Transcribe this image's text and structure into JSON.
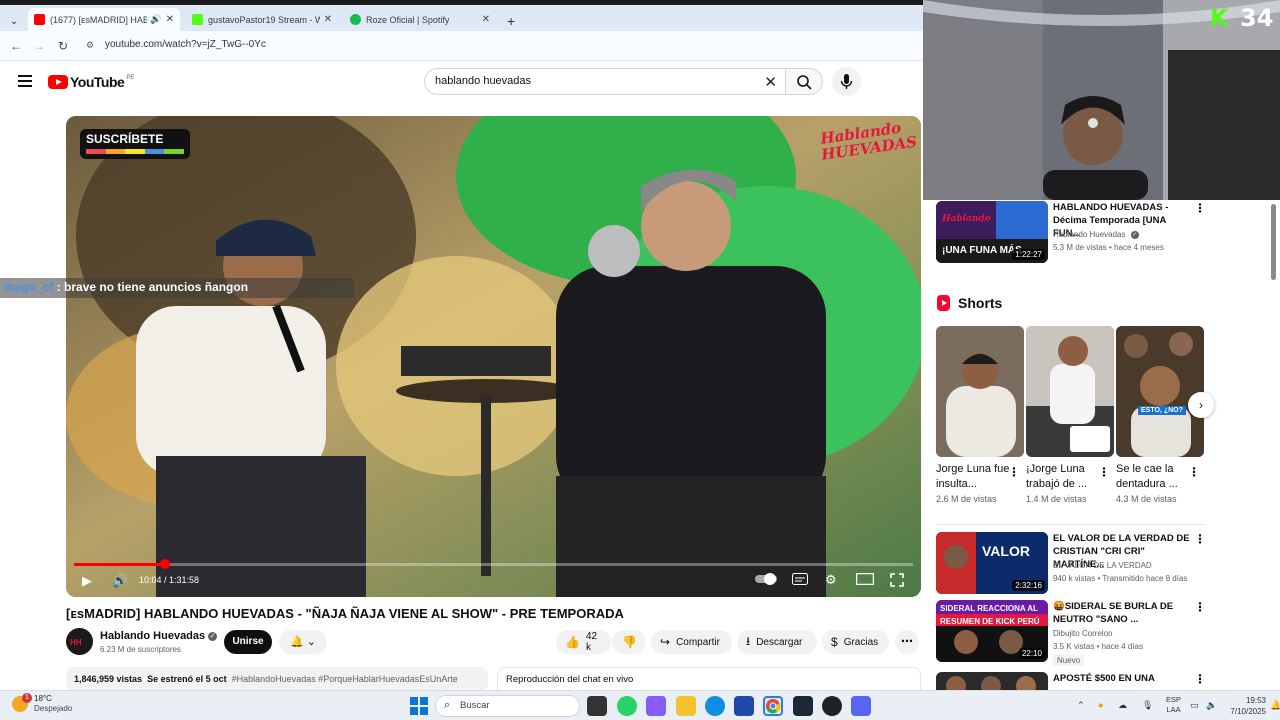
{
  "browser": {
    "tabs": [
      {
        "title": "(1677) [ᴇsMADRID] HABLANDO",
        "active": true,
        "favicon_color": "#ff0000"
      },
      {
        "title": "gustavoPastor19 Stream - Watch",
        "active": false,
        "favicon_color": "#53fc18"
      },
      {
        "title": "Roze Oficial | Spotify",
        "active": false,
        "favicon_color": "#1db954"
      }
    ],
    "url": "youtube.com/watch?v=jZ_TwG--0Yc"
  },
  "youtube": {
    "logo_text": "YouTube",
    "country": "PE",
    "search_value": "hablando huevadas",
    "video": {
      "sub_badge": "SUSCRÍBETE",
      "brand_watermark_line1": "Hablando",
      "brand_watermark_line2": "HUEVADAS",
      "chat_user": "mago_cf",
      "chat_message": " : brave no tiene anuncios ñangon",
      "time": "10:04 / 1:31:58",
      "progress": 0.109
    },
    "title": "[ᴇsMADRID] HABLANDO HUEVADAS - \"ÑAJA ÑAJA VIENE AL SHOW\" - PRE TEMPORADA",
    "channel": {
      "name": "Hablando Huevadas",
      "subscribers": "6.23 M de suscriptores"
    },
    "join_label": "Unirse",
    "likes": "42 k",
    "share_label": "Compartir",
    "download_label": "Descargar",
    "thanks_label": "Gracias",
    "description": {
      "views": "1,846,959 vistas",
      "premiered": "Se estrenó el 5 oct",
      "tags": "#HablandoHuevadas #PorqueHablarHuevadasEsUnArte"
    },
    "chat_replay_label": "Reproducción del chat en vivo",
    "recommendations_top": [
      {
        "title": "HABLANDO HUEVADAS - Décima Temporada [UNA FUN...",
        "channel": "Hablando Huevadas",
        "meta": "5.3 M de vistas • hace 4 meses",
        "duration": "1:22:27",
        "verified": true
      }
    ],
    "shorts_heading": "Shorts",
    "shorts": [
      {
        "title": "Jorge Luna fue insulta...",
        "views": "2.6 M de vistas"
      },
      {
        "title": "¡Jorge Luna trabajó de ...",
        "views": "1.4 M de vistas"
      },
      {
        "title": "Se le cae la dentadura ...",
        "views": "4.3 M de vistas",
        "caption": "ESTO, ¿NO?"
      }
    ],
    "recommendations_bottom": [
      {
        "title": "EL VALOR DE LA VERDAD DE CRISTIAN \"CRI CRI\" MARTÍNE...",
        "channel": "EL VALOR DE LA VERDAD",
        "meta": "940 k vistas • Transmitido hace 8 días",
        "duration": "2:32:16"
      },
      {
        "title": "🤬SIDERAL SE BURLA DE NEUTRO \"SANO ...",
        "channel": "Dibujito Correlon",
        "meta": "3.5 K vistas • hace 4 días",
        "duration": "22:10",
        "badge": "Nuevo"
      },
      {
        "title": "APOSTÉ $500 EN UNA",
        "channel": "",
        "meta": ""
      }
    ]
  },
  "stream_overlay": {
    "logo": "K",
    "number": "34"
  },
  "taskbar": {
    "weather_temp": "18°C",
    "weather_cond": "Despejado",
    "weather_badge": "1",
    "search_placeholder": "Buscar",
    "lang_line1": "ESP",
    "lang_line2": "LAA",
    "time": "19:53",
    "date": "7/10/2025"
  }
}
